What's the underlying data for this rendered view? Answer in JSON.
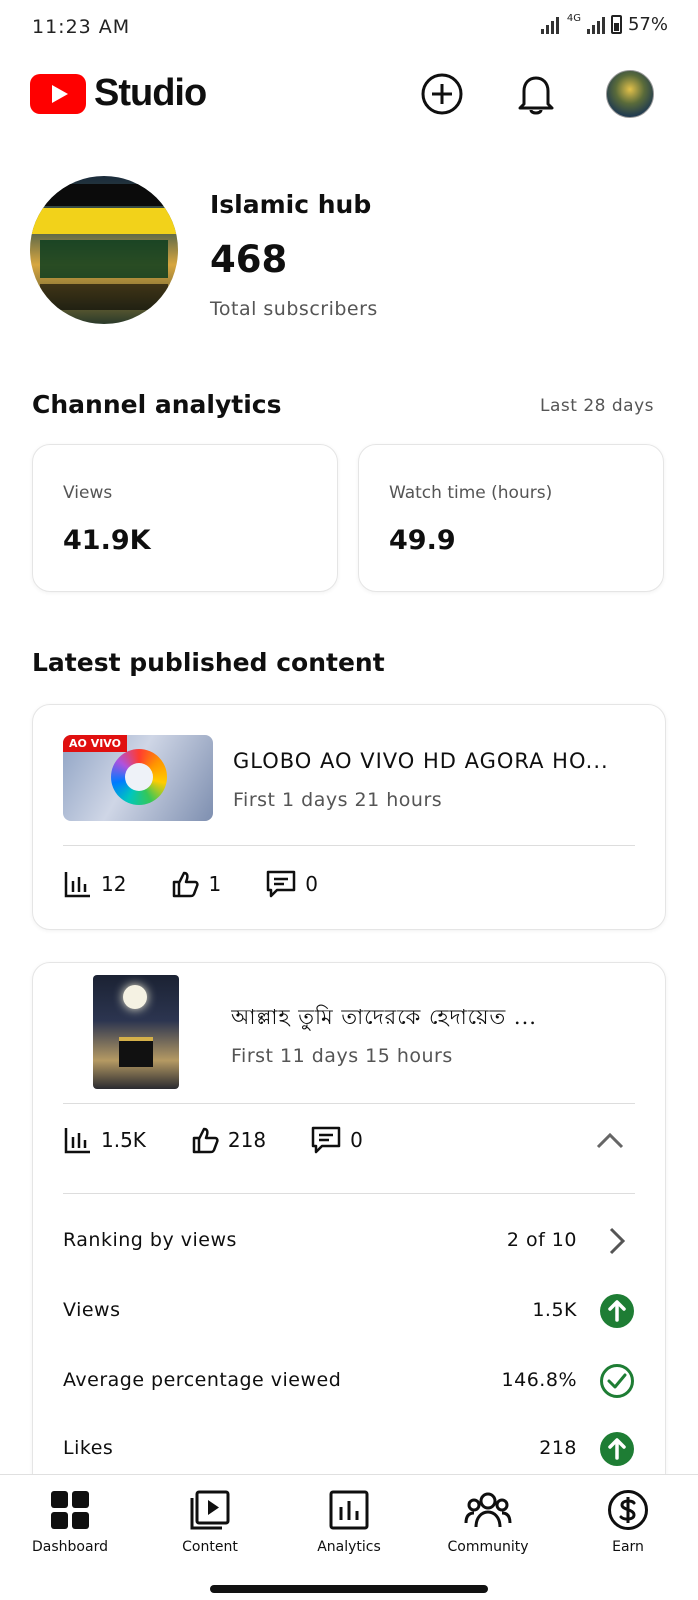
{
  "status_bar": {
    "time": "11:23 AM",
    "network": "4G",
    "battery": "57%"
  },
  "app_bar": {
    "logo_text": "Studio",
    "icons": [
      "create-icon",
      "notifications-icon",
      "account-avatar"
    ]
  },
  "channel": {
    "name": "Islamic hub",
    "subscribers": "468",
    "subscribers_label": "Total subscribers"
  },
  "analytics": {
    "title": "Channel analytics",
    "range": "Last 28 days",
    "cards": [
      {
        "label": "Views",
        "value": "41.9K"
      },
      {
        "label": "Watch time (hours)",
        "value": "49.9"
      }
    ]
  },
  "latest": {
    "title": "Latest published content",
    "videos": [
      {
        "thumbnail_tag": "AO VIVO",
        "title": "GLOBO AO VIVO HD AGORA HO...",
        "age": "First 1 days 21 hours",
        "views": "12",
        "likes": "1",
        "comments": "0"
      },
      {
        "title": "আল্লাহ তুমি তাদেরকে হেদায়েত ...",
        "age": "First 11 days 15 hours",
        "views": "1.5K",
        "likes": "218",
        "comments": "0",
        "details": [
          {
            "label": "Ranking by views",
            "value": "2 of 10",
            "icon": "chevron-right-icon"
          },
          {
            "label": "Views",
            "value": "1.5K",
            "icon": "arrow-up-icon"
          },
          {
            "label": "Average percentage viewed",
            "value": "146.8%",
            "icon": "check-circle-icon"
          },
          {
            "label": "Likes",
            "value": "218",
            "icon": "arrow-up-icon"
          }
        ]
      }
    ]
  },
  "bottom_nav": [
    {
      "label": "Dashboard",
      "icon": "dashboard-icon"
    },
    {
      "label": "Content",
      "icon": "content-icon"
    },
    {
      "label": "Analytics",
      "icon": "analytics-icon"
    },
    {
      "label": "Community",
      "icon": "community-icon"
    },
    {
      "label": "Earn",
      "icon": "earn-icon"
    }
  ],
  "colors": {
    "brand_red": "#ff0000",
    "good_green": "#1e7d34",
    "text": "#0f0f0f",
    "muted": "#555555"
  }
}
